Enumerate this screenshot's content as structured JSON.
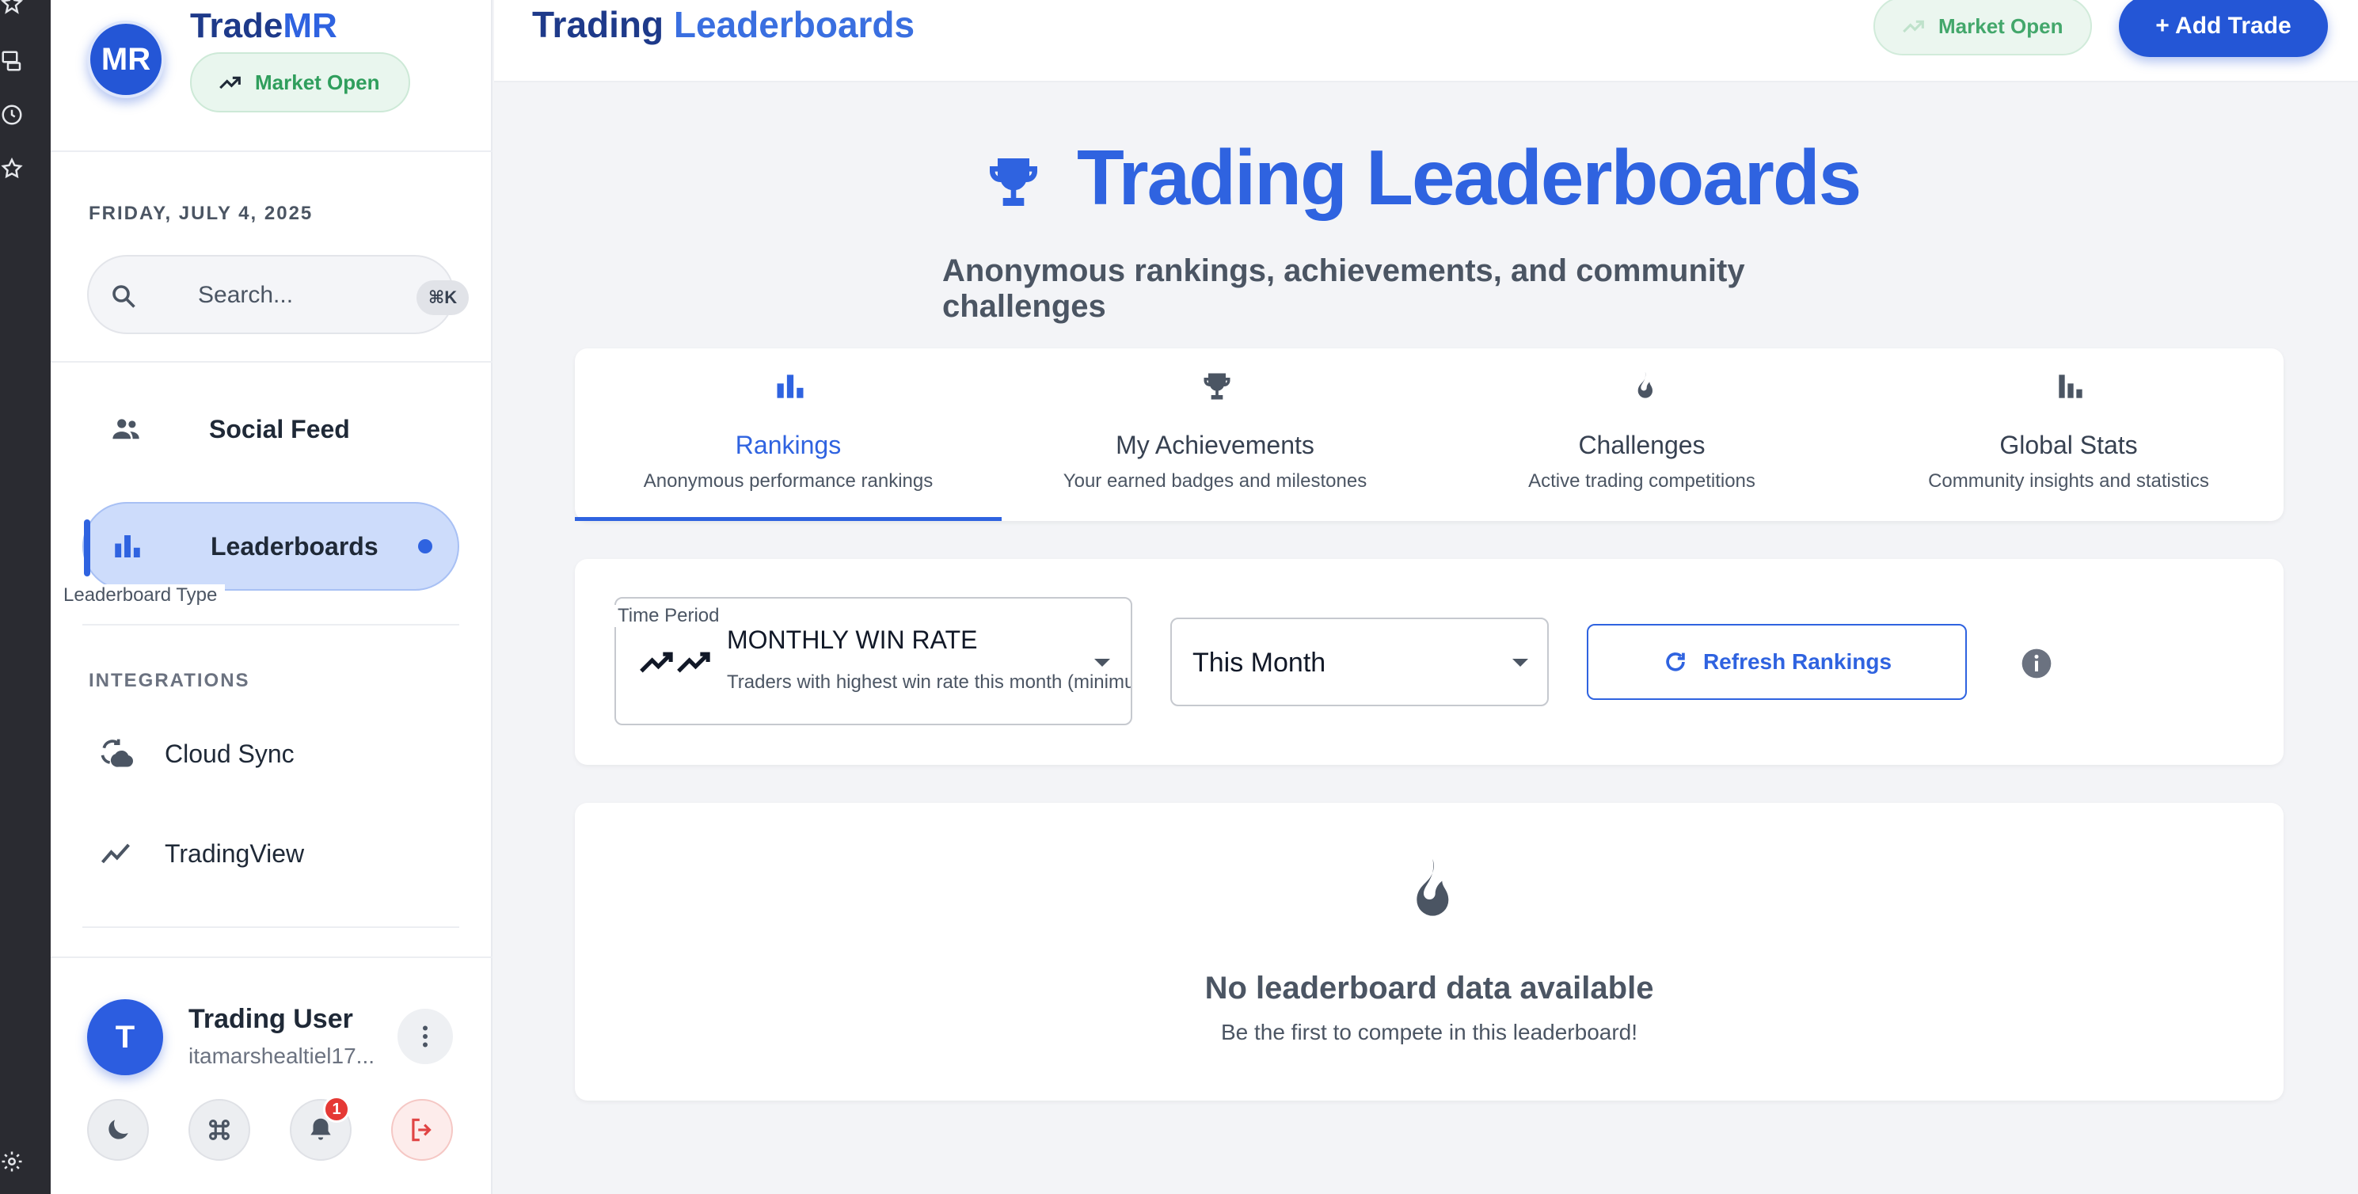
{
  "app": {
    "brand_initials": "MR",
    "brand_name_prefix": "Trade",
    "brand_name_suffix": "MR",
    "market_status": "Market Open"
  },
  "sidebar": {
    "date": "FRIDAY, JULY 4, 2025",
    "search": {
      "placeholder": "Search...",
      "shortcut": "⌘K"
    },
    "nav": [
      {
        "label": "Social Feed",
        "icon": "people-icon",
        "active": false
      },
      {
        "label": "Leaderboards",
        "icon": "bar-chart-icon",
        "active": true
      }
    ],
    "integrations_label": "INTEGRATIONS",
    "integrations": [
      {
        "label": "Cloud Sync",
        "icon": "cloud-sync-icon"
      },
      {
        "label": "TradingView",
        "icon": "trend-line-icon"
      }
    ],
    "user": {
      "initial": "T",
      "name": "Trading User",
      "email": "itamarshealtiel17...",
      "notification_count": "1"
    }
  },
  "topbar": {
    "title_part1": "Trading ",
    "title_part2": "Leaderboards",
    "market_status": "Market Open",
    "add_trade_label": "+ Add Trade"
  },
  "hero": {
    "title": "Trading Leaderboards",
    "subtitle": "Anonymous rankings, achievements, and community challenges"
  },
  "tabs": [
    {
      "title": "Rankings",
      "subtitle": "Anonymous performance rankings",
      "icon": "bar-chart-icon",
      "active": true
    },
    {
      "title": "My Achievements",
      "subtitle": "Your earned badges and milestones",
      "icon": "trophy-icon",
      "active": false
    },
    {
      "title": "Challenges",
      "subtitle": "Active trading competitions",
      "icon": "flame-icon",
      "active": false
    },
    {
      "title": "Global Stats",
      "subtitle": "Community insights and statistics",
      "icon": "stats-icon",
      "active": false
    }
  ],
  "filters": {
    "leaderboard_type_label": "Leaderboard Type",
    "leaderboard_type_value": "MONTHLY WIN RATE",
    "leaderboard_type_desc": "Traders with highest win rate this month (minimum",
    "time_period_label": "Time Period",
    "time_period_value": "This Month",
    "refresh_label": "Refresh Rankings"
  },
  "empty_state": {
    "title": "No leaderboard data available",
    "subtitle": "Be the first to compete in this leaderboard!"
  },
  "colors": {
    "accent": "#2f63e0",
    "brand_dark": "#1e3a8a",
    "market_green": "#2f9e5c",
    "sidebar_active": "#cddcfb",
    "rail": "#2a2b31"
  }
}
